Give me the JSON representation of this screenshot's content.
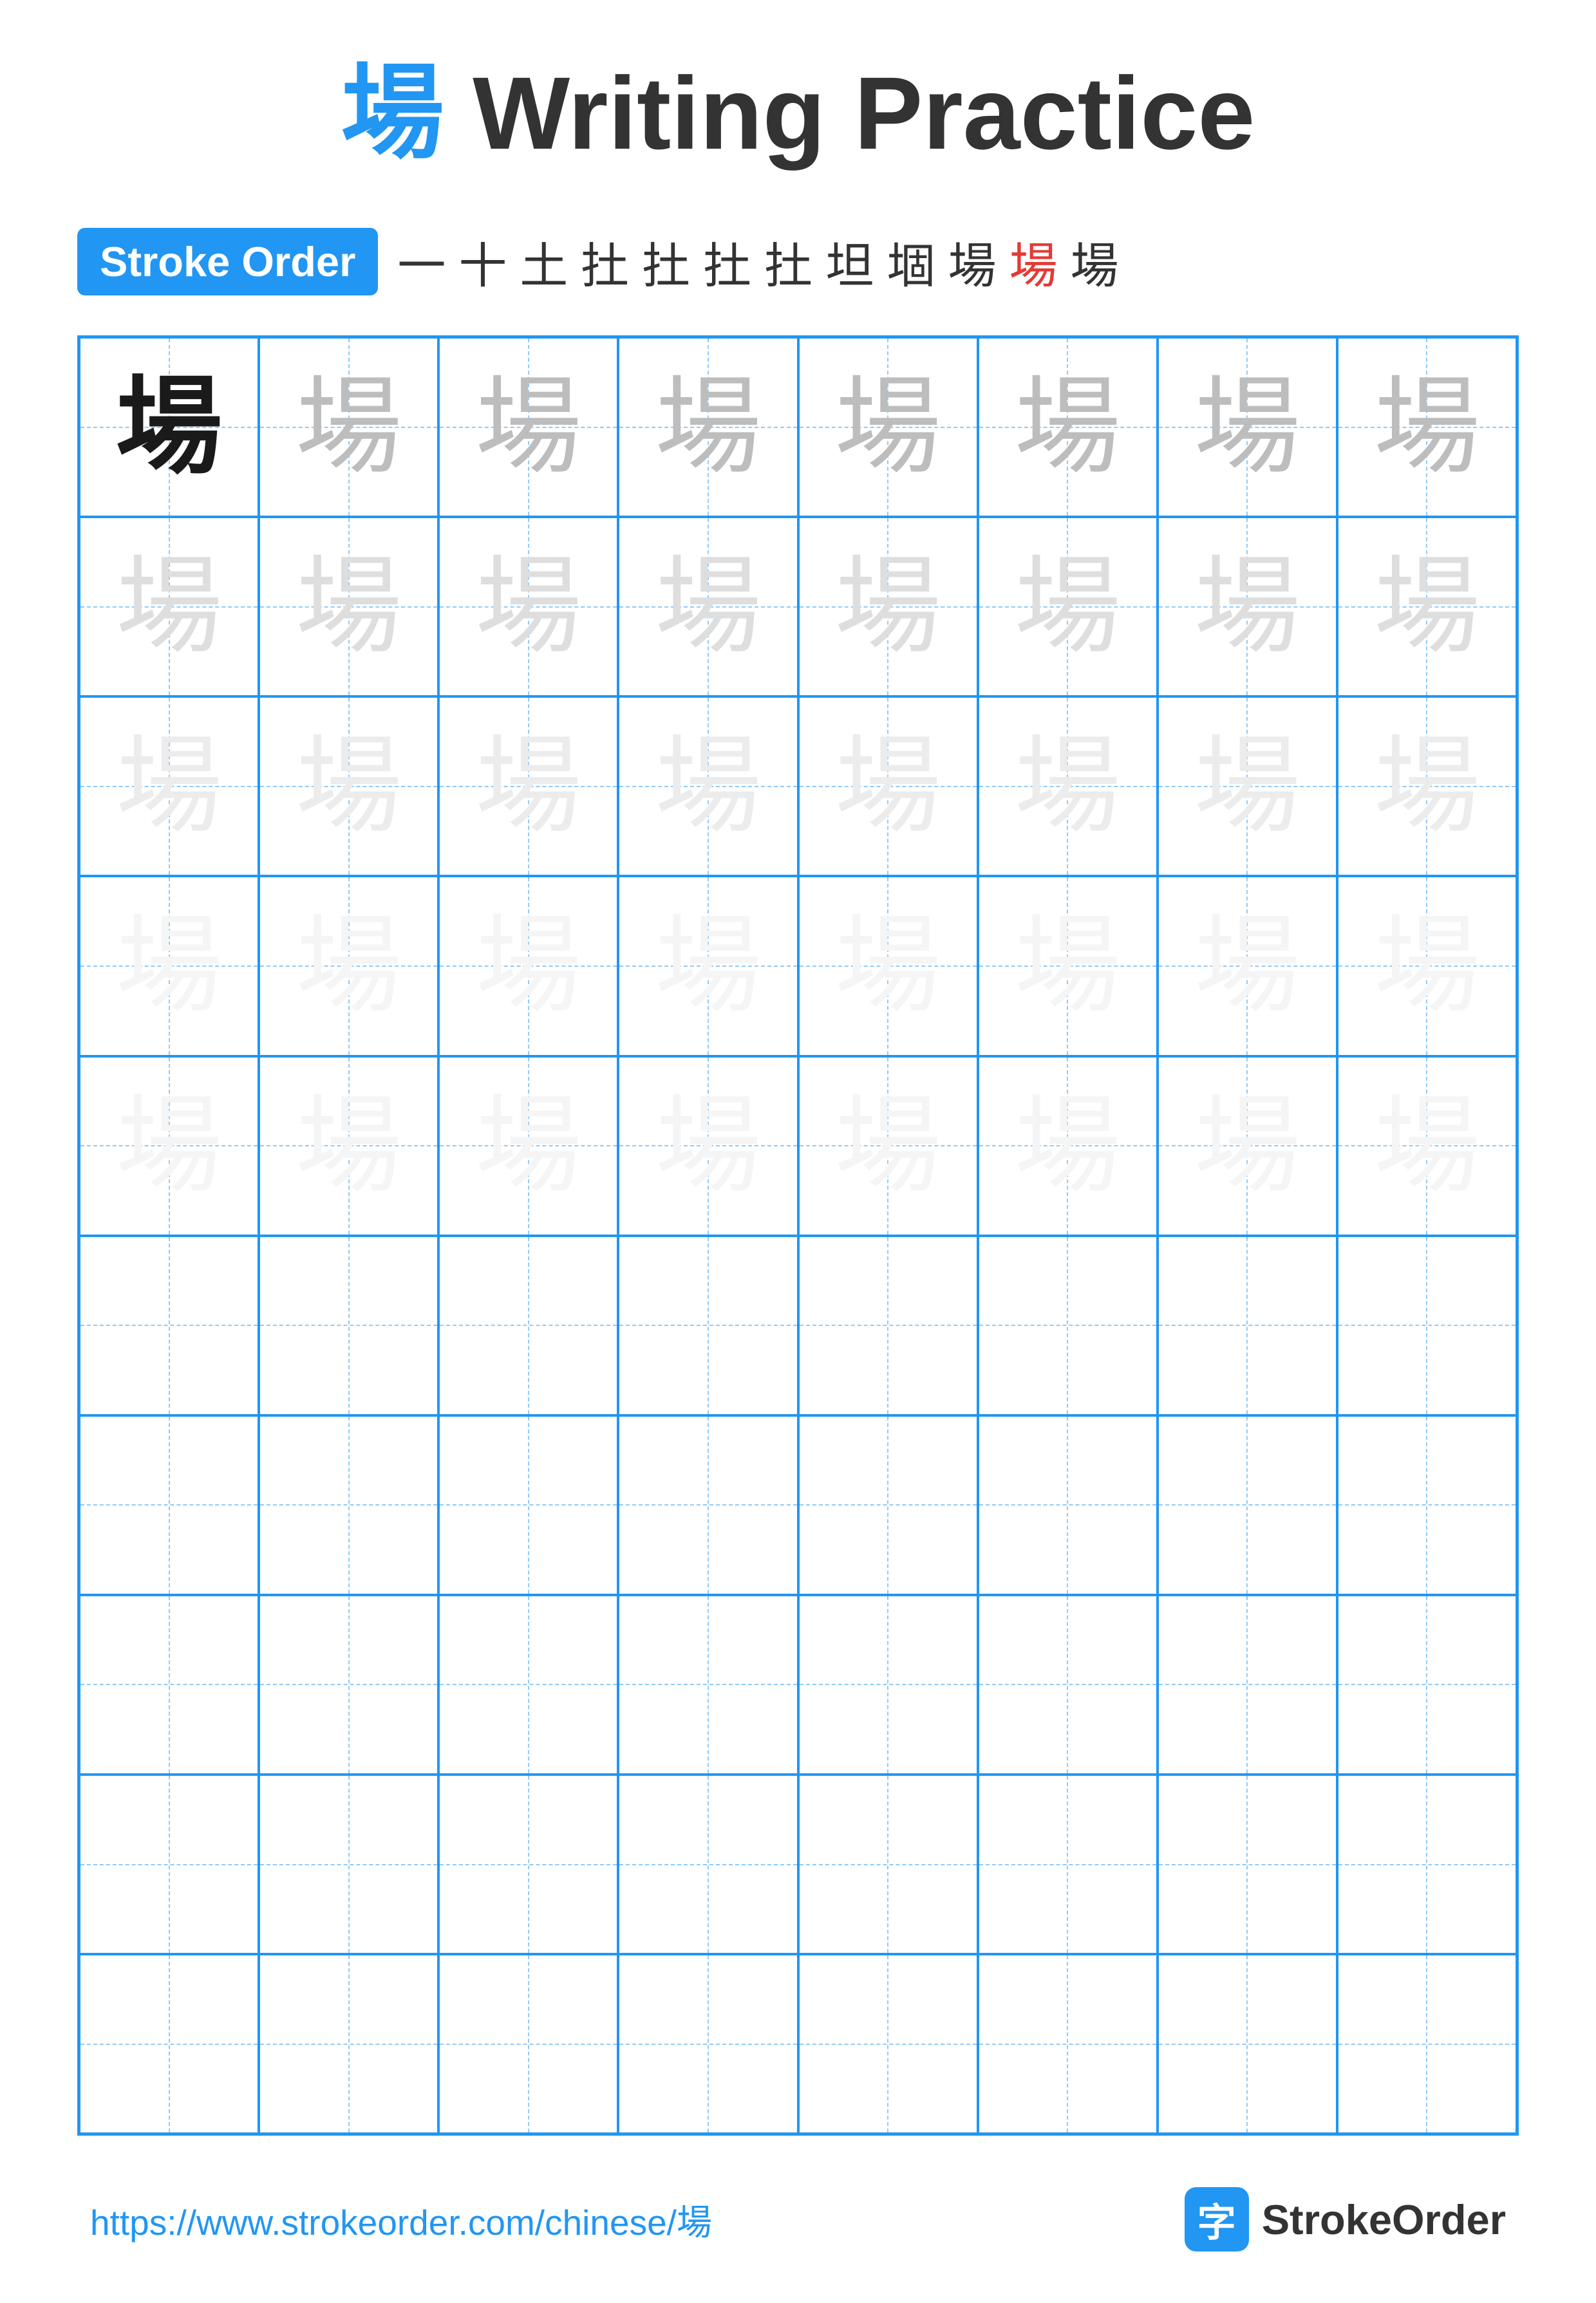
{
  "title": {
    "char": "場",
    "text": " Writing Practice"
  },
  "stroke_order": {
    "badge_label": "Stroke Order",
    "sequence": [
      "一",
      "十",
      "土",
      "扗",
      "扗",
      "扗",
      "扗",
      "坦",
      "堌",
      "場",
      "場",
      "場"
    ]
  },
  "grid": {
    "rows": 10,
    "cols": 8,
    "char": "場",
    "practice_rows": [
      [
        "dark",
        "medium",
        "medium",
        "medium",
        "medium",
        "medium",
        "medium",
        "medium"
      ],
      [
        "light",
        "light",
        "light",
        "light",
        "light",
        "light",
        "light",
        "light"
      ],
      [
        "very-light",
        "very-light",
        "very-light",
        "very-light",
        "very-light",
        "very-light",
        "very-light",
        "very-light"
      ],
      [
        "lightest",
        "lightest",
        "lightest",
        "lightest",
        "lightest",
        "lightest",
        "lightest",
        "lightest"
      ],
      [
        "lightest",
        "lightest",
        "lightest",
        "lightest",
        "lightest",
        "lightest",
        "lightest",
        "lightest"
      ],
      [
        "empty",
        "empty",
        "empty",
        "empty",
        "empty",
        "empty",
        "empty",
        "empty"
      ],
      [
        "empty",
        "empty",
        "empty",
        "empty",
        "empty",
        "empty",
        "empty",
        "empty"
      ],
      [
        "empty",
        "empty",
        "empty",
        "empty",
        "empty",
        "empty",
        "empty",
        "empty"
      ],
      [
        "empty",
        "empty",
        "empty",
        "empty",
        "empty",
        "empty",
        "empty",
        "empty"
      ],
      [
        "empty",
        "empty",
        "empty",
        "empty",
        "empty",
        "empty",
        "empty",
        "empty"
      ]
    ]
  },
  "footer": {
    "url": "https://www.strokeorder.com/chinese/場",
    "brand_icon": "字",
    "brand_name": "StrokeOrder"
  }
}
